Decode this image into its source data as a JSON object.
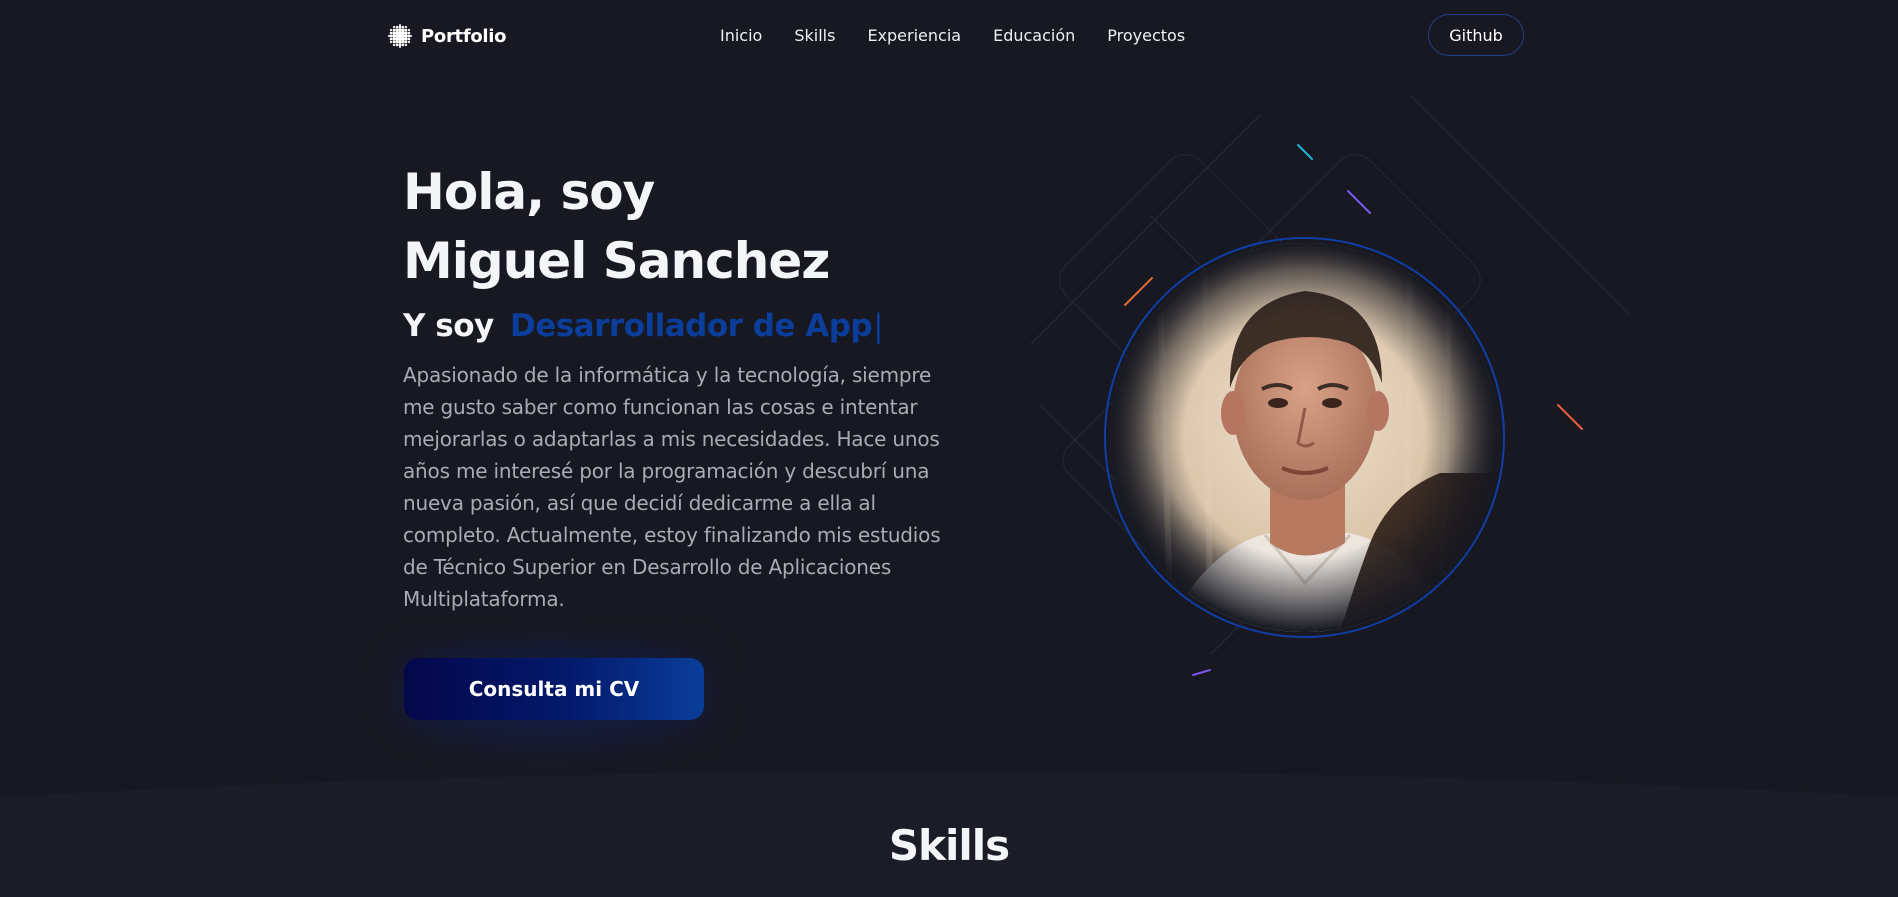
{
  "nav": {
    "brand": "Portfolio",
    "links": [
      "Inicio",
      "Skills",
      "Experiencia",
      "Educación",
      "Proyectos"
    ],
    "github_label": "Github"
  },
  "hero": {
    "greeting_line1": "Hola, soy",
    "greeting_line2": "Miguel Sanchez",
    "role_prefix": "Y soy",
    "role_typed": "Desarrollador de App",
    "caret": "|",
    "description": "Apasionado de la informática y la tecnología, siempre me gusto saber como funcionan las cosas e intentar mejorarlas o adaptarlas a mis necesidades. Hace unos años me interesé por la programación y descubrí una nueva pasión, así que decidí dedicarme a ella al completo. Actualmente, estoy finalizando mis estudios de Técnico Superior en Desarrollo de Aplicaciones Multiplataforma.",
    "cv_button": "Consulta mi CV"
  },
  "skills": {
    "title": "Skills"
  },
  "colors": {
    "background": "#171821",
    "accent_blue": "#0b3d9a",
    "ring_blue": "#0f3ea6",
    "text_muted": "#a9abb5"
  },
  "icons": {
    "brand": "dot-grid-logo-icon"
  }
}
